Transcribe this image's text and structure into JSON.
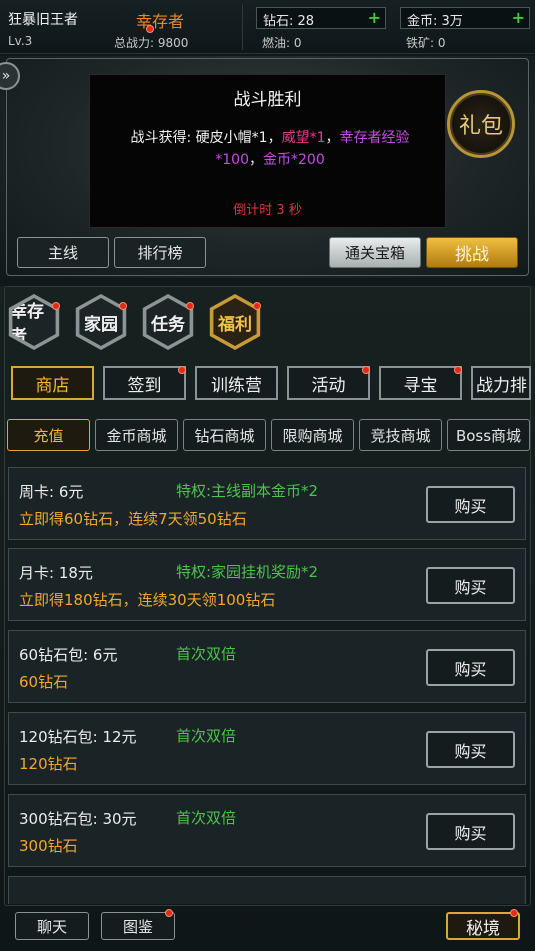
{
  "player": {
    "name": "狂暴旧王者",
    "level": "Lv.3",
    "role": "幸存者",
    "power": "总战力: 9800"
  },
  "resources": {
    "diamond": "钻石: 28",
    "gold": "金币: 3万",
    "fuel": "燃油: 0",
    "iron": "铁矿: 0",
    "plus": "+"
  },
  "battle": {
    "side_arrow": "»",
    "victory_title": "战斗胜利",
    "rewards_prefix": "战斗获得: 硬皮小帽*1，",
    "rewards_prestige": "威望*1",
    "rewards_sep": "，",
    "rewards_exp": "幸存者经验*100",
    "rewards_sep2": "，",
    "rewards_gold": "金币*200",
    "countdown": "倒计时 3 秒",
    "gift_label": "礼包",
    "btn_main": "主线",
    "btn_rank": "排行榜",
    "btn_chest": "通关宝箱",
    "btn_challenge": "挑战"
  },
  "main_tabs": [
    "幸存者",
    "家园",
    "任务",
    "福利"
  ],
  "sub_tabs": [
    "商店",
    "签到",
    "训练营",
    "活动",
    "寻宝",
    "战力排"
  ],
  "shop_tabs": [
    "充值",
    "金币商城",
    "钻石商城",
    "限购商城",
    "竞技商城",
    "Boss商城"
  ],
  "products": [
    {
      "name": "周卡: 6元",
      "perk": "特权:主线副本金币*2",
      "desc": "立即得60钻石，连续7天领50钻石",
      "button": "购买"
    },
    {
      "name": "月卡: 18元",
      "perk": "特权:家园挂机奖励*2",
      "desc": "立即得180钻石，连续30天领100钻石",
      "button": "购买"
    },
    {
      "name": "60钻石包: 6元",
      "perk": "首次双倍",
      "desc": "60钻石",
      "button": "购买"
    },
    {
      "name": "120钻石包: 12元",
      "perk": "首次双倍",
      "desc": "120钻石",
      "button": "购买"
    },
    {
      "name": "300钻石包: 30元",
      "perk": "首次双倍",
      "desc": "300钻石",
      "button": "购买"
    }
  ],
  "bottom": {
    "chat": "聊天",
    "codex": "图鉴",
    "secret": "秘境"
  },
  "colors": {
    "accent_gold": "#d8a838",
    "perk_green": "#4ec24e",
    "desc_orange": "#f0a830",
    "role_orange": "#e8882a",
    "countdown_red": "#d83a3a"
  }
}
